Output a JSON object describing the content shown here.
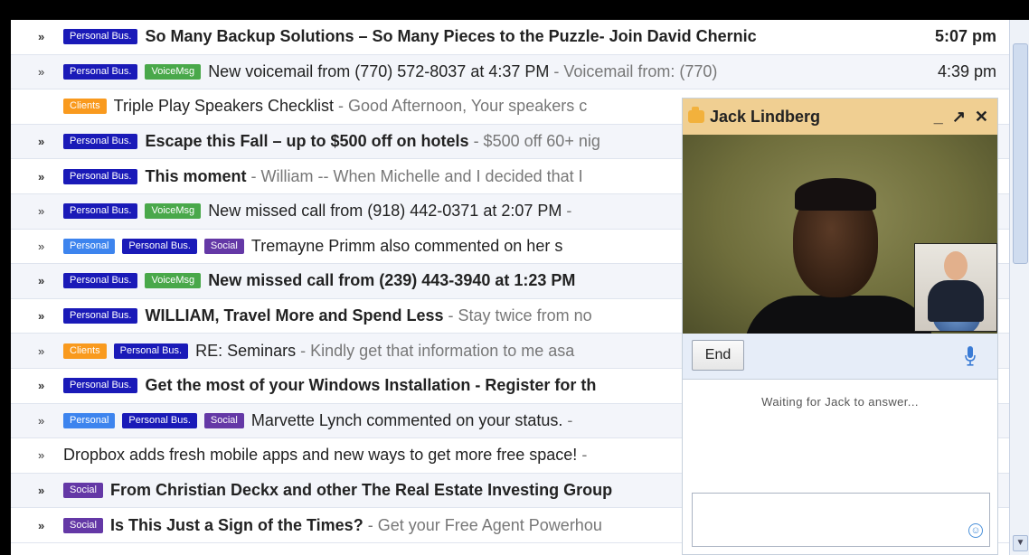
{
  "colors": {
    "personal_bus": "#1a1ab8",
    "voicemsg": "#49a84a",
    "clients": "#f99a1e",
    "personal": "#3d84ee",
    "social": "#6438a6"
  },
  "emails": [
    {
      "labels": [
        "Personal Bus."
      ],
      "subject": "So Many Backup Solutions – So Many Pieces to the Puzzle- Join David Chernic",
      "snippet": "",
      "time": "5:07 pm",
      "unread": true,
      "chevron": "»"
    },
    {
      "labels": [
        "Personal Bus.",
        "VoiceMsg"
      ],
      "subject": "New voicemail from (770) 572-8037 at 4:37 PM",
      "snippet": " - Voicemail from: (770)",
      "time": "4:39 pm",
      "unread": false,
      "chevron": "»"
    },
    {
      "labels": [
        "Clients"
      ],
      "subject": "Triple Play Speakers Checklist",
      "snippet": " - Good Afternoon, Your speakers c",
      "time": "",
      "unread": false,
      "chevron": ""
    },
    {
      "labels": [
        "Personal Bus."
      ],
      "subject": "Escape this Fall – up to $500 off on hotels",
      "snippet": " - $500 off 60+ nig",
      "time": "",
      "unread": true,
      "chevron": "»"
    },
    {
      "labels": [
        "Personal Bus."
      ],
      "subject": "This moment",
      "snippet": " - William -- When Michelle and I decided that I",
      "time": "",
      "unread": true,
      "chevron": "»"
    },
    {
      "labels": [
        "Personal Bus.",
        "VoiceMsg"
      ],
      "subject": "New missed call from (918) 442-0371 at 2:07 PM",
      "snippet": " -",
      "time": "",
      "unread": false,
      "chevron": "»"
    },
    {
      "labels": [
        "Personal",
        "Personal Bus.",
        "Social"
      ],
      "subject": "Tremayne Primm also commented on her s",
      "snippet": "",
      "time": "",
      "unread": false,
      "chevron": "»"
    },
    {
      "labels": [
        "Personal Bus.",
        "VoiceMsg"
      ],
      "subject": "New missed call from (239) 443-3940 at 1:23 PM",
      "snippet": "",
      "time": "",
      "unread": true,
      "chevron": "»"
    },
    {
      "labels": [
        "Personal Bus."
      ],
      "subject": "WILLIAM, Travel More and Spend Less",
      "snippet": " - Stay twice from no",
      "time": "",
      "unread": true,
      "chevron": "»"
    },
    {
      "labels": [
        "Clients",
        "Personal Bus."
      ],
      "subject": "RE: Seminars",
      "snippet": " - Kindly get that information to me asa",
      "time": "",
      "unread": false,
      "chevron": "»"
    },
    {
      "labels": [
        "Personal Bus."
      ],
      "subject": "Get the most of your Windows Installation - Register for th",
      "snippet": "",
      "time": "",
      "unread": true,
      "chevron": "»"
    },
    {
      "labels": [
        "Personal",
        "Personal Bus.",
        "Social"
      ],
      "subject": "Marvette Lynch commented on your status.",
      "snippet": " -",
      "time": "",
      "unread": false,
      "chevron": "»"
    },
    {
      "labels": [],
      "subject": "Dropbox adds fresh mobile apps and new ways to get more free space!",
      "snippet": " -",
      "time": "",
      "unread": false,
      "chevron": "»"
    },
    {
      "labels": [
        "Social"
      ],
      "subject": "From Christian Deckx and other The Real Estate Investing Group",
      "snippet": "",
      "time": "",
      "unread": true,
      "chevron": "»"
    },
    {
      "labels": [
        "Social"
      ],
      "subject": "Is This Just a Sign of the Times?",
      "snippet": " - Get your Free Agent Powerhou",
      "time": "",
      "unread": true,
      "chevron": "»"
    }
  ],
  "chat": {
    "contact_name": "Jack Lindberg",
    "minimize": "_",
    "popout": "↗",
    "close": "✕",
    "end_button": "End",
    "status": "Waiting for Jack to answer...",
    "message_value": ""
  },
  "icons": {
    "chat": "chat-bubble-icon",
    "mic": "microphone-icon",
    "smiley": "smiley-icon",
    "scroll_down": "chevron-down-icon"
  }
}
